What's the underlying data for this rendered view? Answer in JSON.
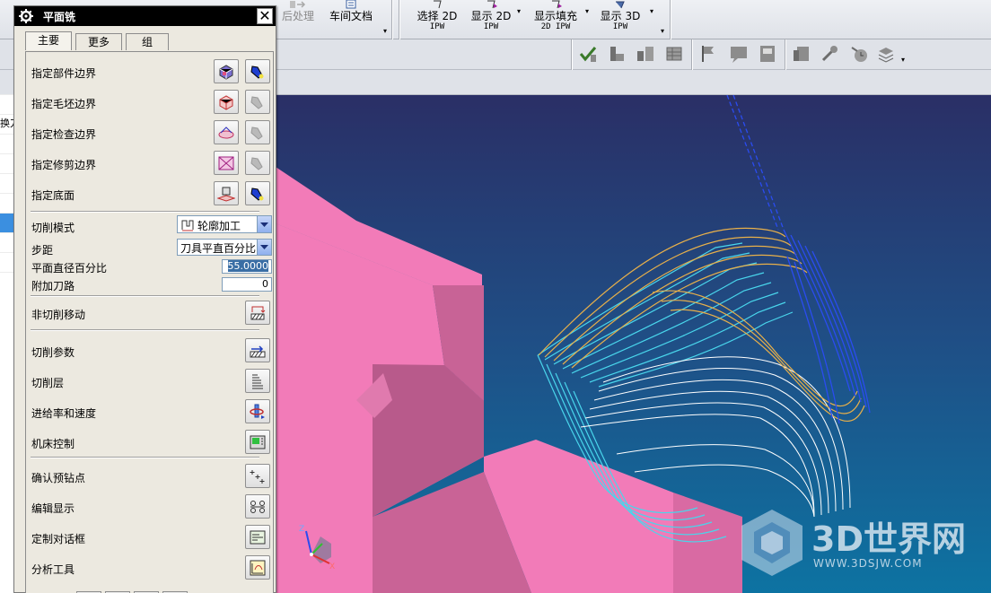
{
  "toolbar": {
    "postprocess_label": "后处理",
    "shop_doc_label": "车间文档",
    "select2d_label": "选择 2D",
    "select2d_sub": "IPW",
    "show2d_label": "显示 2D",
    "show2d_sub": "IPW",
    "showfill_label": "显示填充",
    "showfill_sub": "2D IPW",
    "show3d_label": "显示 3D",
    "show3d_sub": "IPW"
  },
  "left_strip": {
    "tool_label": "换刀"
  },
  "dialog": {
    "title": "平面铣",
    "tabs": [
      {
        "label": "主要",
        "active": true
      },
      {
        "label": "更多",
        "active": false
      },
      {
        "label": "组",
        "active": false
      }
    ],
    "geometry_items": [
      {
        "label": "指定部件边界"
      },
      {
        "label": "指定毛坯边界"
      },
      {
        "label": "指定检查边界"
      },
      {
        "label": "指定修剪边界"
      },
      {
        "label": "指定底面"
      }
    ],
    "cut_mode": {
      "label": "切削模式",
      "value": "轮廓加工"
    },
    "stepover": {
      "label": "步距",
      "value": "刀具平直百分比"
    },
    "flat_diameter_percent": {
      "label": "平面直径百分比",
      "value": "55.0000"
    },
    "additional_passes": {
      "label": "附加刀路",
      "value": "0"
    },
    "non_cutting_moves": {
      "label": "非切削移动"
    },
    "action_items": [
      {
        "label": "切削参数"
      },
      {
        "label": "切削层"
      },
      {
        "label": "进给率和速度"
      },
      {
        "label": "机床控制"
      }
    ],
    "misc_items": [
      {
        "label": "确认预钻点"
      },
      {
        "label": "编辑显示"
      },
      {
        "label": "定制对话框"
      },
      {
        "label": "分析工具"
      }
    ]
  },
  "viewport": {
    "triad_labels": {
      "z": "Z",
      "x": "X"
    }
  },
  "watermark": {
    "brand": "3D世界网",
    "url": "WWW.3DSJW.COM"
  }
}
